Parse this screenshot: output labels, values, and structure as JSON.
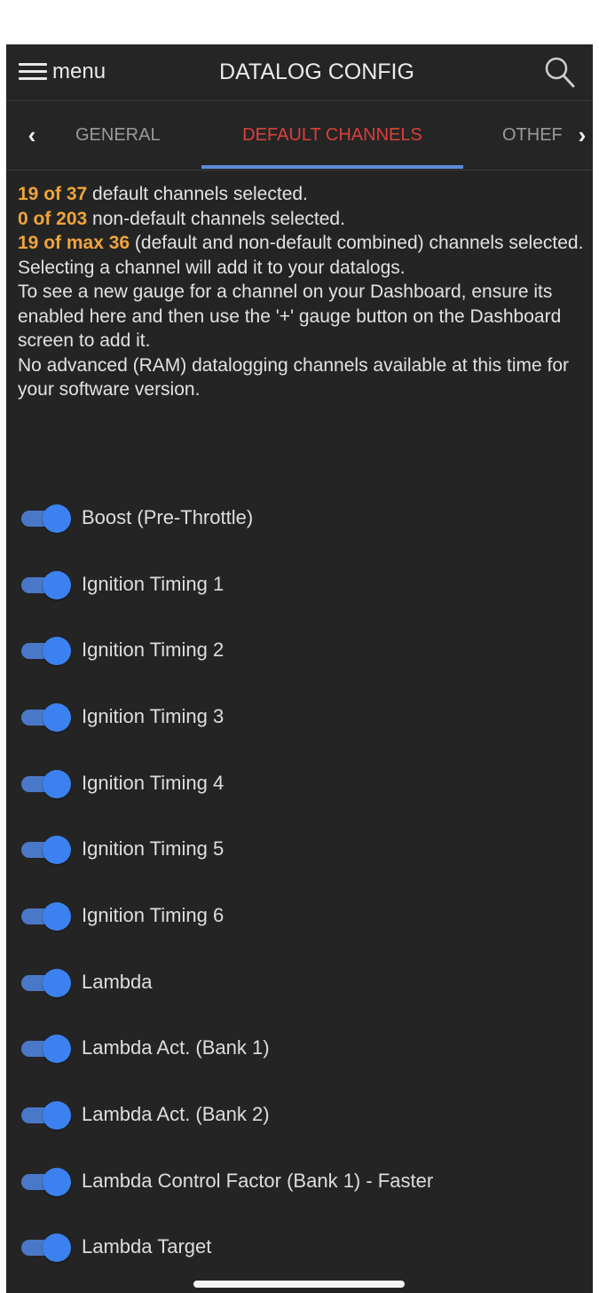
{
  "header": {
    "menu_label": "menu",
    "title": "DATALOG CONFIG",
    "search_icon": "search-icon"
  },
  "tabs": {
    "left_arrow": "‹",
    "right_arrow": "›",
    "items": [
      {
        "label": "GENERAL",
        "active": false
      },
      {
        "label": "DEFAULT CHANNELS",
        "active": true
      },
      {
        "label": "OTHEF",
        "active": false
      }
    ],
    "active_color": "#d8413a",
    "underline_color": "#5b8dd8"
  },
  "info": {
    "default_count": "19 of 37",
    "default_text": " default channels selected.",
    "nondefault_count": "0 of 203",
    "nondefault_text": " non-default channels selected.",
    "max_count": "19 of max 36",
    "max_text": " (default and non-default combined) channels selected.",
    "line_add": "Selecting a channel will add it to your datalogs.",
    "line_gauge": "To see a new gauge for a channel on your Dashboard, ensure its enabled here and then use the '+' gauge button on the Dashboard screen to add it.",
    "line_ram": "No advanced (RAM) datalogging channels available at this time for your software version.",
    "highlight_color": "#f0a43a"
  },
  "channels": [
    {
      "label": "Boost (Pre-Throttle)",
      "enabled": true
    },
    {
      "label": "Ignition Timing 1",
      "enabled": true
    },
    {
      "label": "Ignition Timing 2",
      "enabled": true
    },
    {
      "label": "Ignition Timing 3",
      "enabled": true
    },
    {
      "label": "Ignition Timing 4",
      "enabled": true
    },
    {
      "label": "Ignition Timing 5",
      "enabled": true
    },
    {
      "label": "Ignition Timing 6",
      "enabled": true
    },
    {
      "label": "Lambda",
      "enabled": true
    },
    {
      "label": "Lambda Act. (Bank 1)",
      "enabled": true
    },
    {
      "label": "Lambda Act. (Bank 2)",
      "enabled": true
    },
    {
      "label": "Lambda Control Factor (Bank 1) - Faster",
      "enabled": true
    },
    {
      "label": "Lambda Target",
      "enabled": true
    }
  ],
  "toggle_color": "#3b82f0"
}
